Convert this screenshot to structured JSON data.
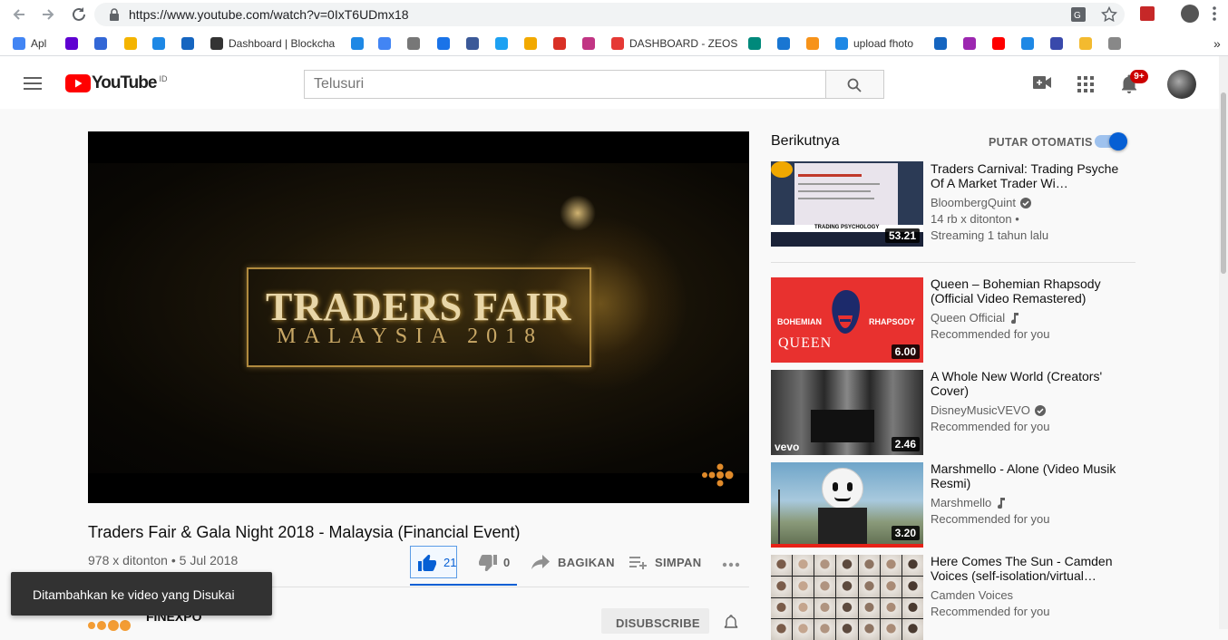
{
  "browser": {
    "url": "https://www.youtube.com/watch?v=0IxT6UDmx18",
    "bookmarks": [
      {
        "label": "Apl",
        "icon": "apps-grid-icon",
        "color": "#4285f4"
      },
      {
        "label": "",
        "icon": "yahoo-icon",
        "color": "#5f01d1"
      },
      {
        "label": "",
        "icon": "four-icon",
        "color": "#3367d6"
      },
      {
        "label": "",
        "icon": "triangle-icon",
        "color": "#f4b400"
      },
      {
        "label": "",
        "icon": "pie-icon",
        "color": "#1e88e5"
      },
      {
        "label": "",
        "icon": "bitcoin-icon",
        "color": "#1565c0"
      },
      {
        "label": "Dashboard | Blockcha",
        "icon": "cube-icon",
        "color": "#333"
      },
      {
        "label": "",
        "icon": "p-icon",
        "color": "#1e88e5"
      },
      {
        "label": "",
        "icon": "translate-icon",
        "color": "#4285f4"
      },
      {
        "label": "",
        "icon": "page-icon",
        "color": "#777"
      },
      {
        "label": "",
        "icon": "bird-icon",
        "color": "#1a73e8"
      },
      {
        "label": "",
        "icon": "facebook-icon",
        "color": "#3b5998"
      },
      {
        "label": "",
        "icon": "twitter-icon",
        "color": "#1da1f2"
      },
      {
        "label": "",
        "icon": "coin-icon",
        "color": "#f2a900"
      },
      {
        "label": "",
        "icon": "gmail-icon",
        "color": "#d93025"
      },
      {
        "label": "",
        "icon": "instagram-icon",
        "color": "#c13584"
      },
      {
        "label": "DASHBOARD - ZEOS",
        "icon": "zeos-icon",
        "color": "#e53935"
      },
      {
        "label": "",
        "icon": "circle-icon",
        "color": "#00897b"
      },
      {
        "label": "",
        "icon": "diamond-icon",
        "color": "#1976d2"
      },
      {
        "label": "",
        "icon": "bitcoin-orange-icon",
        "color": "#f7931a"
      },
      {
        "label": "upload fhoto",
        "icon": "ibb-icon",
        "color": "#1e88e5"
      },
      {
        "label": "",
        "icon": "yo-icon",
        "color": "#1565c0"
      },
      {
        "label": "",
        "icon": "play-store-icon",
        "color": "#9c27b0"
      },
      {
        "label": "",
        "icon": "youtube-icon",
        "color": "#ff0000"
      },
      {
        "label": "",
        "icon": "edit-icon",
        "color": "#1e88e5"
      },
      {
        "label": "",
        "icon": "eth-icon",
        "color": "#3949ab"
      },
      {
        "label": "",
        "icon": "binance-icon",
        "color": "#f3ba2f"
      },
      {
        "label": "",
        "icon": "tray-icon",
        "color": "#888"
      }
    ],
    "more_label": "»"
  },
  "header": {
    "logo_text": "YouTube",
    "country": "ID",
    "search_placeholder": "Telusuri",
    "notif_count": "9+"
  },
  "video": {
    "title": "Traders Fair & Gala Night 2018 - Malaysia (Financial Event)",
    "views_date": "978 x ditonton • 5 Jul 2018",
    "likes": "21",
    "dislikes": "0",
    "share_label": "BAGIKAN",
    "save_label": "SIMPAN",
    "overlay_title": "TRADERS FAIR",
    "overlay_subtitle": "MALAYSIA 2018",
    "channel": "FINEXPO",
    "subscribe_label": "DISUBSCRIBE"
  },
  "toast": "Ditambahkan ke video yang Disukai",
  "sidebar": {
    "next_label": "Berikutnya",
    "autoplay_label": "PUTAR OTOMATIS",
    "autoplay_on": true,
    "items": [
      {
        "title": "Traders Carnival: Trading Psyche Of A Market Trader Wi…",
        "channel": "BloombergQuint",
        "badge": "verified",
        "meta1": "14 rb x ditonton •",
        "meta2": "Streaming 1 tahun lalu",
        "duration": "53.21"
      },
      {
        "title": "Queen – Bohemian Rhapsody (Official Video Remastered)",
        "channel": "Queen Official",
        "badge": "music",
        "meta1": "Recommended for you",
        "meta2": "",
        "duration": "6.00"
      },
      {
        "title": "A Whole New World (Creators' Cover)",
        "channel": "DisneyMusicVEVO",
        "badge": "verified",
        "meta1": "Recommended for you",
        "meta2": "",
        "duration": "2.46"
      },
      {
        "title": "Marshmello - Alone (Video Musik Resmi)",
        "channel": "Marshmello",
        "badge": "music",
        "meta1": "Recommended for you",
        "meta2": "",
        "duration": "3.20"
      },
      {
        "title": "Here Comes The Sun - Camden Voices (self-isolation/virtual…",
        "channel": "Camden Voices",
        "badge": "",
        "meta1": "Recommended for you",
        "meta2": "",
        "duration": ""
      }
    ],
    "thumb_texts": {
      "queen_left": "BOHEMIAN",
      "queen_right": "RHAPSODY",
      "queen_logo": "QUEEN",
      "vevo": "vevo",
      "trading": "TRADING PSYCHOLOGY"
    }
  },
  "colors": {
    "youtube_red": "#ff0000",
    "link_blue": "#065fd4",
    "toggle_blue": "#065fd4"
  }
}
